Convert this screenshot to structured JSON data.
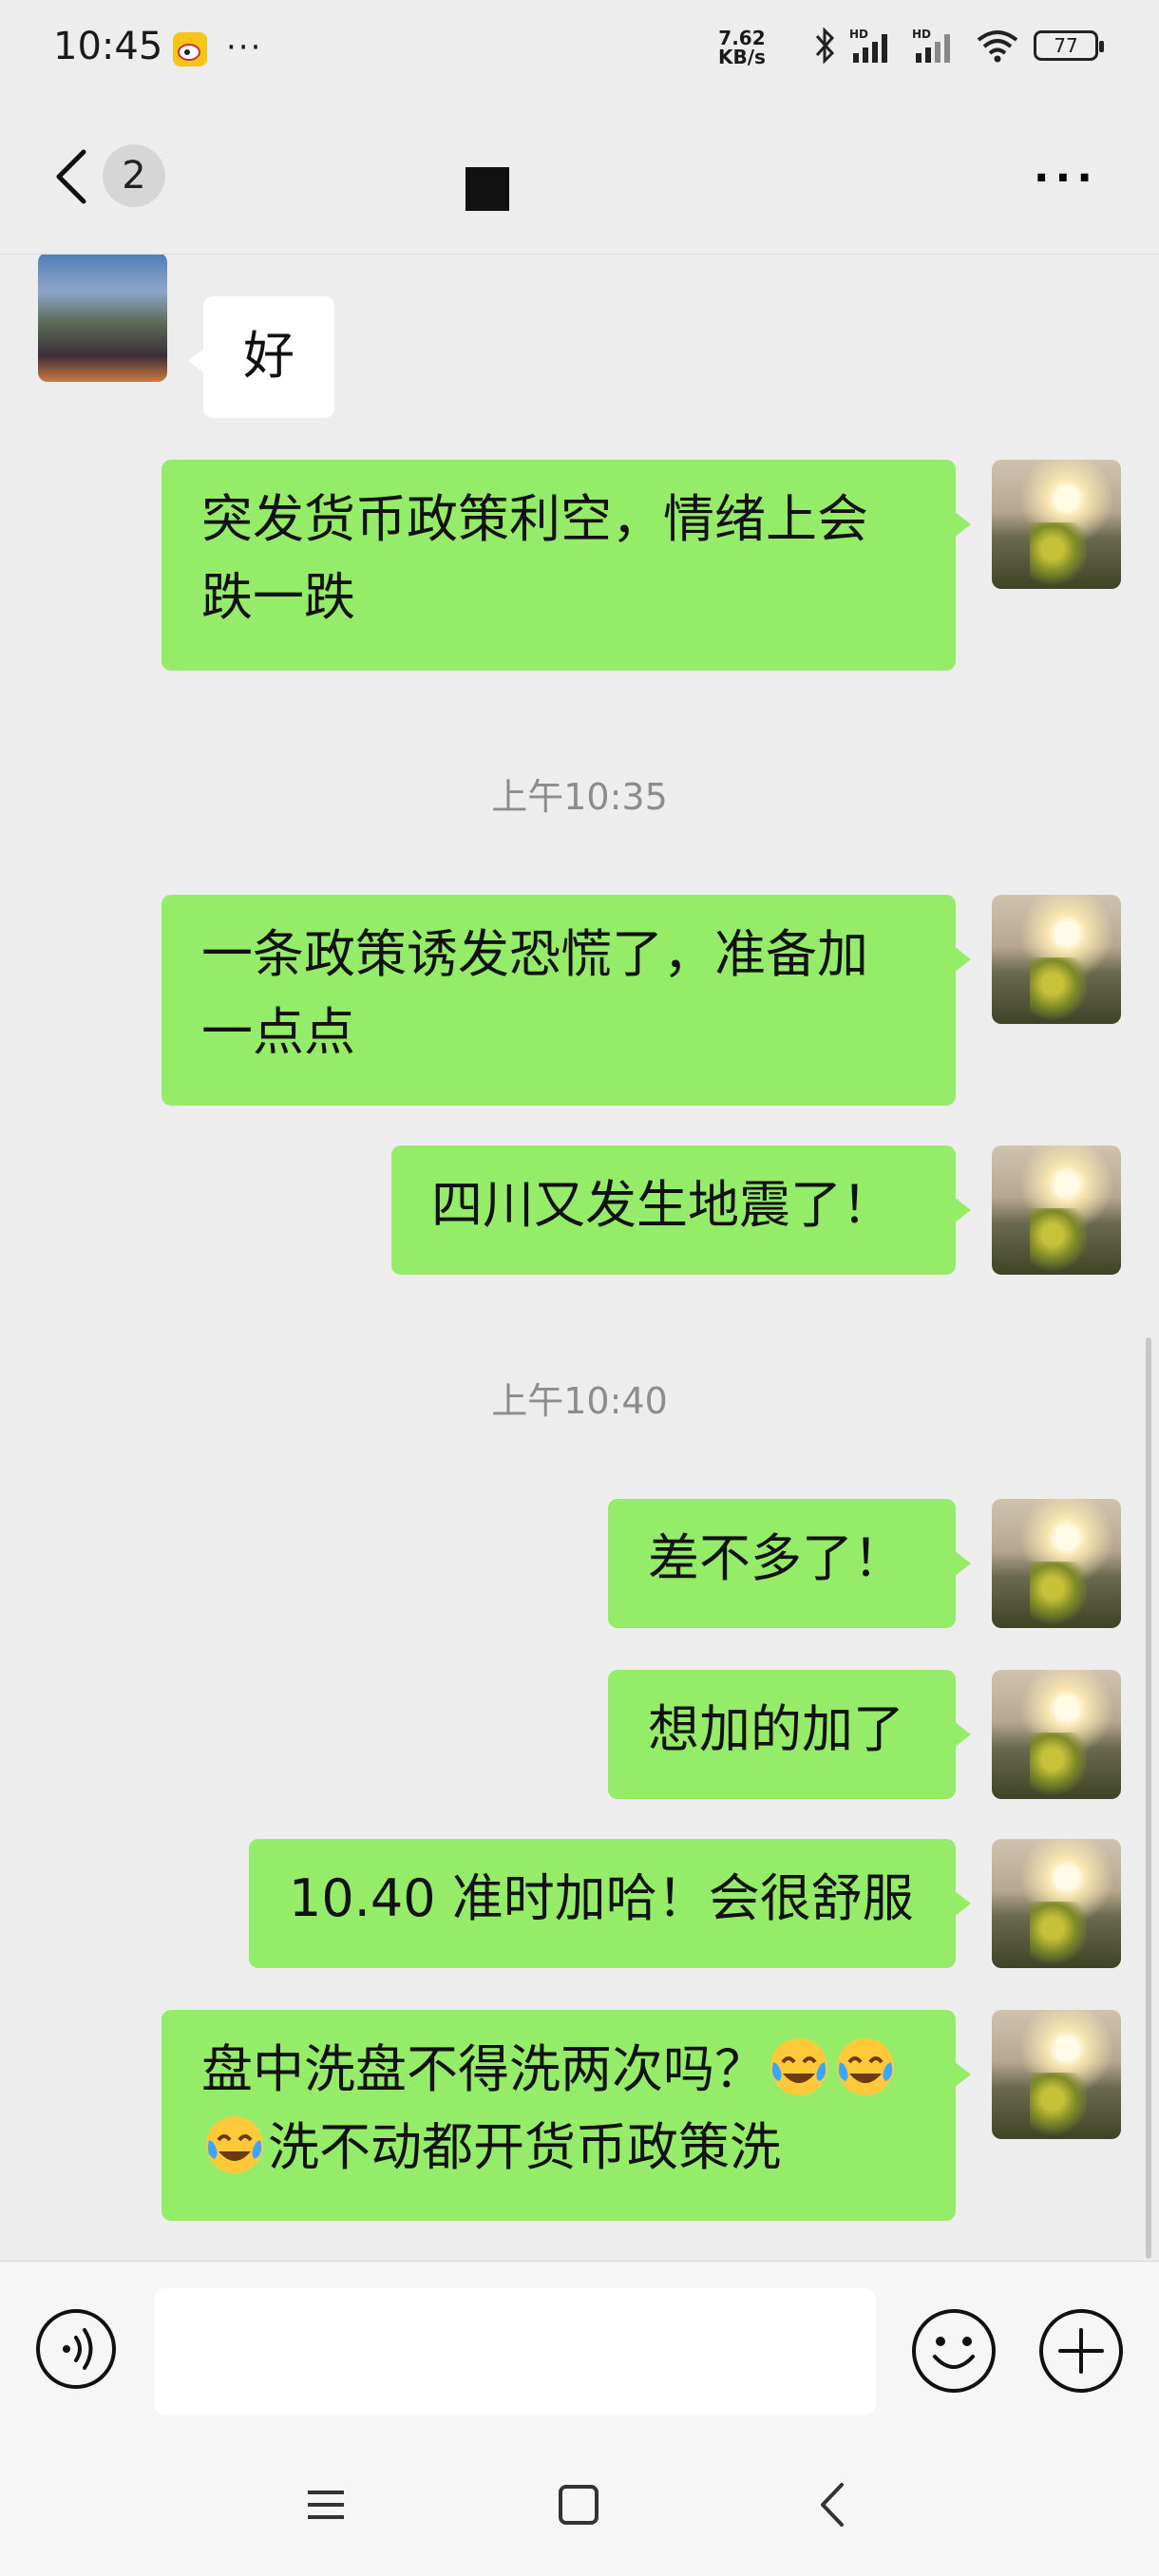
{
  "status_bar": {
    "time": "10:45",
    "net_speed_value": "7.62",
    "net_speed_unit": "KB/s",
    "battery": "77",
    "icons": [
      "weibo-icon",
      "more-dots-icon",
      "bluetooth-icon",
      "signal-hd-icon",
      "signal-hd-icon",
      "wifi-icon",
      "battery-icon"
    ]
  },
  "nav": {
    "unread_count": "2",
    "title": "",
    "more_label": "···"
  },
  "messages": [
    {
      "from": "other",
      "text": "好"
    },
    {
      "from": "self",
      "text": "突发货币政策利空，情绪上会跌一跌"
    },
    {
      "type": "time",
      "text": "上午10:35"
    },
    {
      "from": "self",
      "text": "一条政策诱发恐慌了，准备加一点点"
    },
    {
      "from": "self",
      "text": "四川又发生地震了！"
    },
    {
      "type": "time",
      "text": "上午10:40"
    },
    {
      "from": "self",
      "text": "差不多了！"
    },
    {
      "from": "self",
      "text": "想加的加了"
    },
    {
      "from": "self",
      "text": "10.40 准时加哈！会很舒服"
    },
    {
      "from": "self",
      "text_before": "盘中洗盘不得洗两次吗？",
      "text_after": "洗不动都开货币政策洗",
      "emoji": "face-with-tears-of-joy"
    }
  ],
  "input": {
    "placeholder": ""
  },
  "colors": {
    "self_bubble": "#95ec69",
    "other_bubble": "#ffffff",
    "background": "#ededed"
  }
}
